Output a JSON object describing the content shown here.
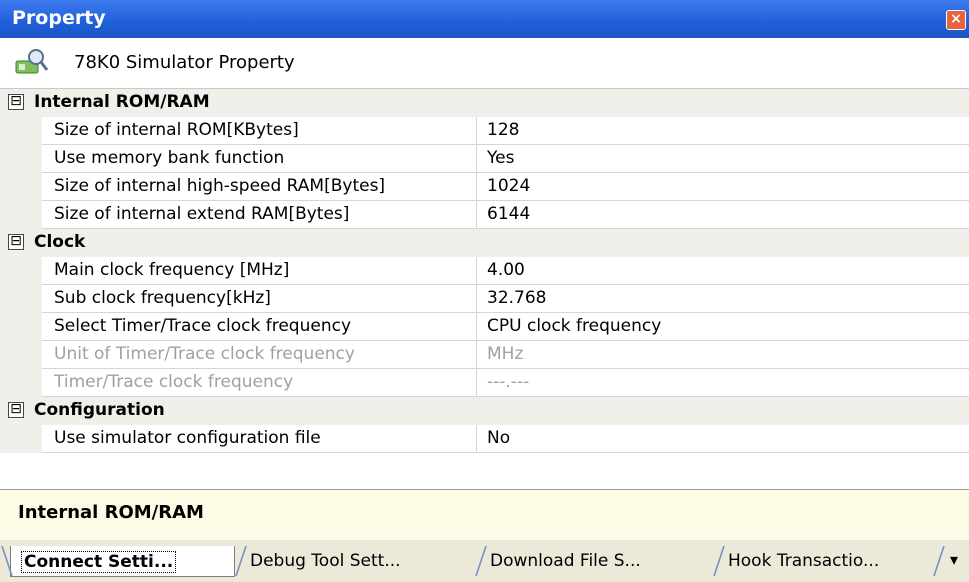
{
  "window": {
    "title": "Property",
    "close_symbol": "×"
  },
  "heading": {
    "text": "78K0 Simulator Property",
    "icon": "simulator-property-icon"
  },
  "categories": [
    {
      "label": "Internal ROM/RAM",
      "expander": "⊟",
      "rows": [
        {
          "name": "Size of internal ROM[KBytes]",
          "value": "128",
          "disabled": false
        },
        {
          "name": "Use memory bank function",
          "value": "Yes",
          "disabled": false
        },
        {
          "name": "Size of internal high-speed RAM[Bytes]",
          "value": "1024",
          "disabled": false
        },
        {
          "name": "Size of internal extend RAM[Bytes]",
          "value": "6144",
          "disabled": false
        }
      ]
    },
    {
      "label": "Clock",
      "expander": "⊟",
      "rows": [
        {
          "name": "Main clock frequency [MHz]",
          "value": "4.00",
          "disabled": false
        },
        {
          "name": "Sub clock frequency[kHz]",
          "value": "32.768",
          "disabled": false
        },
        {
          "name": "Select Timer/Trace clock frequency",
          "value": "CPU clock frequency",
          "disabled": false
        },
        {
          "name": "Unit of Timer/Trace clock frequency",
          "value": "MHz",
          "disabled": true
        },
        {
          "name": "Timer/Trace clock frequency",
          "value": "---.---",
          "disabled": true
        }
      ]
    },
    {
      "label": "Configuration",
      "expander": "⊟",
      "rows": [
        {
          "name": "Use simulator configuration file",
          "value": "No",
          "disabled": false
        }
      ]
    }
  ],
  "description": {
    "text": "Internal ROM/RAM"
  },
  "tabs": [
    {
      "label": "Connect Setti...",
      "active": true
    },
    {
      "label": "Debug Tool Sett...",
      "active": false
    },
    {
      "label": "Download File S...",
      "active": false
    },
    {
      "label": "Hook Transactio...",
      "active": false
    }
  ],
  "tab_overflow_symbol": "▾",
  "colors": {
    "titlebar": "#1f5fd9",
    "category_bg": "#f0efe9",
    "description_bg": "#fdfbe6",
    "disabled_text": "#a0a0a0"
  }
}
